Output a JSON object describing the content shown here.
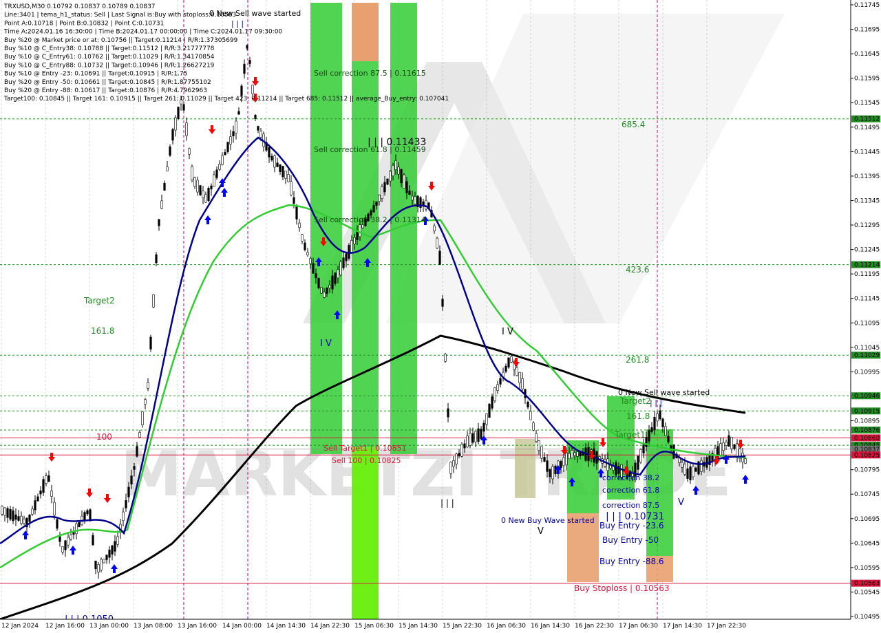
{
  "colors": {
    "background": "#ffffff",
    "grid": "#dadada",
    "bull_candle": "#000000",
    "bear_candle": "#000000",
    "ma_fast": "#00008b",
    "ma_mid": "#32cd32",
    "ma_slow": "#000000",
    "zone_green": "#32cd32",
    "zone_green_light": "#7cfc00",
    "zone_orange": "#e9a070",
    "zone_olive": "#c8c89a",
    "level_green": "#228b22",
    "level_red": "#dc143c",
    "arrow_buy": "#0000ff",
    "arrow_sell": "#ff0000",
    "vline": "#cc0077"
  },
  "header": {
    "lines": [
      "TRXUSD,M30  0.10792 0.10837 0.10789 0.10837",
      "Line:3401 | tema_h1_status: Sell | Last Signal is:Buy with stoploss:0.10563",
      "Point A:0.10718 | Point B:0.10832 | Point C:0.10731",
      "Time A:2024.01.16 16:30:00 | Time B:2024.01.17 00:00:00 | Time C:2024.01.17 09:30:00",
      "Buy %20 @ Market price or at: 0.10756 || Target:0.11214 | R/R:1.37305699",
      "Buy %10 @ C_Entry38: 0.10788 || Target:0.11512 | R/R:3.21777778",
      "Buy %10 @ C_Entry61: 0.10762 || Target:0.11029 | R/R:1.34170854",
      "Buy %10 @ C_Entry88: 0.10732 || Target:0.10946 | R/R:1.26627219",
      "Buy %10 @ Entry -23: 0.10691 || Target:0.10915 | R/R:1.75",
      "Buy %20 @ Entry -50: 0.10661 || Target:0.10845 | R/R:1.87755102",
      "Buy %20 @ Entry -88: 0.10617 || Target:0.10876 | R/R:4.7962963",
      "Target100: 0.10845 || Target 161: 0.10915 || Target 261: 0.11029 || Target 423: 0.11214 || Target 685: 0.11512 || average_Buy_entry: 0.107041"
    ]
  },
  "price_axis": {
    "ticks": [
      "0.11745",
      "0.11695",
      "0.11645",
      "0.11595",
      "0.11545",
      "0.11495",
      "0.11445",
      "0.11395",
      "0.11345",
      "0.11295",
      "0.11245",
      "0.11195",
      "0.11145",
      "0.11095",
      "0.11045",
      "0.10995",
      "0.10945",
      "0.10895",
      "0.10845",
      "0.10795",
      "0.10745",
      "0.10695",
      "0.10645",
      "0.10595",
      "0.10545",
      "0.10495"
    ],
    "tags": [
      {
        "text": "0.11512",
        "kind": "green",
        "value": 0.11512
      },
      {
        "text": "0.11214",
        "kind": "green",
        "value": 0.11214
      },
      {
        "text": "0.11029",
        "kind": "green",
        "value": 0.11029
      },
      {
        "text": "0.10946",
        "kind": "green",
        "value": 0.10946
      },
      {
        "text": "0.10915",
        "kind": "green",
        "value": 0.10915
      },
      {
        "text": "0.10876",
        "kind": "green",
        "value": 0.10876
      },
      {
        "text": "0.10860",
        "kind": "red",
        "value": 0.1086
      },
      {
        "text": "0.10845",
        "kind": "green",
        "value": 0.10845
      },
      {
        "text": "0.10837",
        "kind": "gray",
        "value": 0.10837
      },
      {
        "text": "0.10825",
        "kind": "red",
        "value": 0.10825
      },
      {
        "text": "0.10563",
        "kind": "red",
        "value": 0.10563
      }
    ]
  },
  "time_axis": {
    "labels": [
      "12 Jan 2024",
      "12 Jan 16:00",
      "13 Jan 00:00",
      "13 Jan 08:00",
      "13 Jan 16:00",
      "14 Jan 00:00",
      "14 Jan 14:30",
      "14 Jan 22:30",
      "15 Jan 06:30",
      "15 Jan 14:30",
      "15 Jan 22:30",
      "16 Jan 06:30",
      "16 Jan 14:30",
      "16 Jan 22:30",
      "17 Jan 06:30",
      "17 Jan 14:30",
      "17 Jan 22:30"
    ]
  },
  "annotations": {
    "sell_wave_top": "0 New Sell wave started",
    "sell_wave_right": "0 New Sell wave started",
    "buy_wave": "0 New Buy Wave started",
    "sell_corr_875": "Sell correction 87.5 | 0.11615",
    "sell_corr_618": "Sell correction 61.8 | 0.11459",
    "sell_corr_382": "Sell correction 38.2 | 0.11314",
    "peak_1": "| | | 0.11433",
    "sell_target1": "Sell Target1 | 0.10851",
    "sell_100": "Sell 100 | 0.10825",
    "target2_left": "Target2",
    "l1618_left": "161.8",
    "l100_left": "100",
    "l6854": "685.4",
    "l4236": "423.6",
    "l2618": "261.8",
    "l1618_right": "161.8",
    "target2_right": "Target2",
    "target1_right": "Target1",
    "corr_382": "correction 38.2",
    "corr_618": "correction 61.8",
    "corr_875": "correction 87.5",
    "point_c": "| | | 0.10731",
    "buy_entry_236": "Buy Entry -23.6",
    "buy_entry_50": "Buy Entry -50",
    "buy_entry_886": "Buy Entry -88.6",
    "buy_stoploss": "Buy Stoploss | 0.10563",
    "low_left": "| | | 0.1050",
    "mark_iv_1": "I V",
    "mark_iv_2": "I V",
    "mark_iii_top": "| | |",
    "mark_iii_mid": "| | |",
    "mark_iii_low": "| | |",
    "mark_v_1": "V",
    "mark_v_2": "V",
    "watermark": "MARKETZI TRADE"
  }
}
